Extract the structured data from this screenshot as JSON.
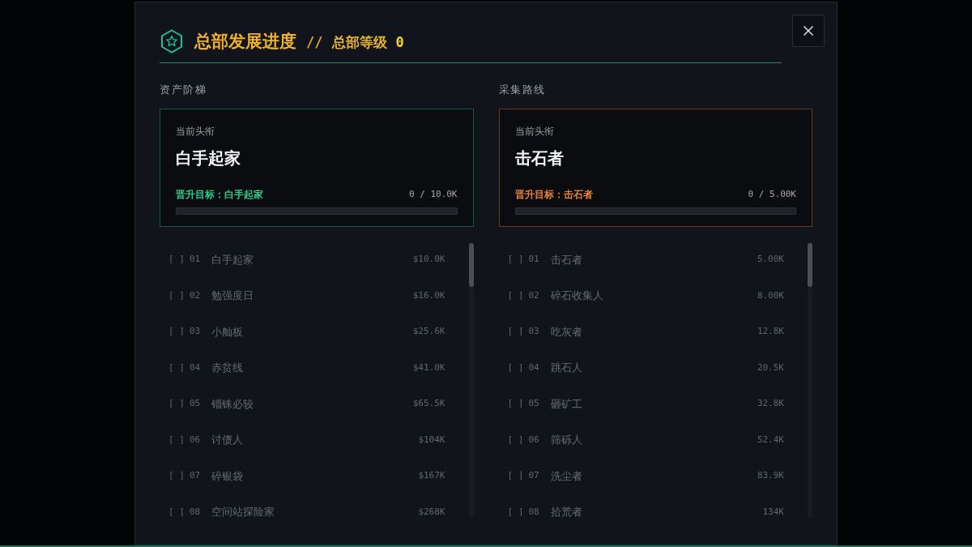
{
  "dialog": {
    "title": "总部发展进度",
    "separator": "//",
    "level_label": "总部等级",
    "level_value": "0"
  },
  "ladders": [
    {
      "heading": "资产阶梯",
      "color": "#2ecc8a",
      "current_label": "当前头衔",
      "current_title": "白手起家",
      "target": "晋升目标：白手起家",
      "progress": "0 / 10.0K",
      "level": 0,
      "items": [
        {
          "box": "[ ]",
          "number": "01",
          "name": "白手起家",
          "value": "$10.0K",
          "reached": false
        },
        {
          "box": "[ ]",
          "number": "02",
          "name": "勉强度日",
          "value": "$16.0K",
          "reached": false
        },
        {
          "box": "[ ]",
          "number": "03",
          "name": "小舢板",
          "value": "$25.6K",
          "reached": false
        },
        {
          "box": "[ ]",
          "number": "04",
          "name": "赤贫线",
          "value": "$41.0K",
          "reached": false
        },
        {
          "box": "[ ]",
          "number": "05",
          "name": "锱铢必较",
          "value": "$65.5K",
          "reached": false
        },
        {
          "box": "[ ]",
          "number": "06",
          "name": "讨债人",
          "value": "$104K",
          "reached": false
        },
        {
          "box": "[ ]",
          "number": "07",
          "name": "碎银袋",
          "value": "$167K",
          "reached": false
        },
        {
          "box": "[ ]",
          "number": "08",
          "name": "空间站探险家",
          "value": "$268K",
          "reached": false
        }
      ]
    },
    {
      "heading": "采集路线",
      "color": "#e8843a",
      "current_label": "当前头衔",
      "current_title": "击石者",
      "target": "晋升目标：击石者",
      "progress": "0 / 5.00K",
      "level": 0,
      "items": [
        {
          "box": "[ ]",
          "number": "01",
          "name": "击石者",
          "value": "5.00K",
          "reached": false
        },
        {
          "box": "[ ]",
          "number": "02",
          "name": "碎石收集人",
          "value": "8.00K",
          "reached": false
        },
        {
          "box": "[ ]",
          "number": "03",
          "name": "吃灰者",
          "value": "12.8K",
          "reached": false
        },
        {
          "box": "[ ]",
          "number": "04",
          "name": "跳石人",
          "value": "20.5K",
          "reached": false
        },
        {
          "box": "[ ]",
          "number": "05",
          "name": "砸矿工",
          "value": "32.8K",
          "reached": false
        },
        {
          "box": "[ ]",
          "number": "06",
          "name": "筛砾人",
          "value": "52.4K",
          "reached": false
        },
        {
          "box": "[ ]",
          "number": "07",
          "name": "洗尘者",
          "value": "83.9K",
          "reached": false
        },
        {
          "box": "[ ]",
          "number": "08",
          "name": "拾荒者",
          "value": "134K",
          "reached": false
        }
      ]
    }
  ]
}
